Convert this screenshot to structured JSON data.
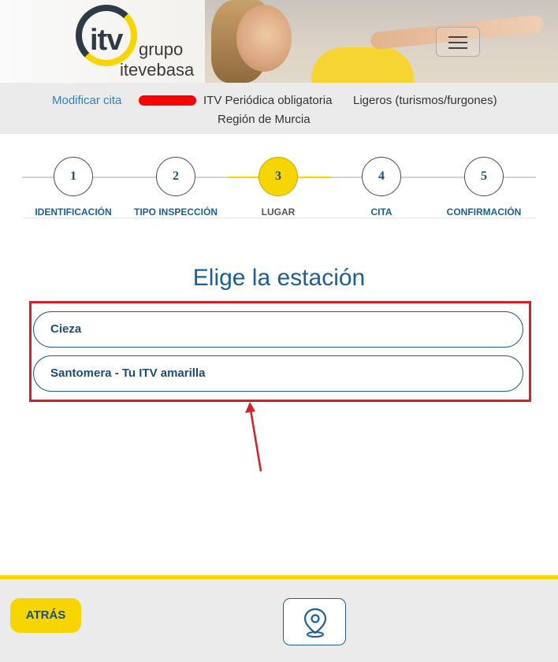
{
  "header": {
    "logo": {
      "mark": "itv",
      "line1": "grupo",
      "line2": "itevebasa"
    },
    "menu_icon": "hamburger-menu-icon"
  },
  "summary": {
    "modify_link": "Modificar cita",
    "inspection_type": "ITV Periódica obligatoria",
    "vehicle_category": "Ligeros (turismos/furgones)",
    "region": "Región de Murcia"
  },
  "steps": [
    {
      "number": "1",
      "label": "IDENTIFICACIÓN",
      "state": "done"
    },
    {
      "number": "2",
      "label": "TIPO INSPECCIÓN",
      "state": "done"
    },
    {
      "number": "3",
      "label": "LUGAR",
      "state": "current"
    },
    {
      "number": "4",
      "label": "CITA",
      "state": "pending"
    },
    {
      "number": "5",
      "label": "CONFIRMACIÓN",
      "state": "pending"
    }
  ],
  "main": {
    "title": "Elige la estación",
    "stations": [
      "Cieza",
      "Santomera - Tu ITV amarilla"
    ]
  },
  "footer": {
    "back_label": "ATRÁS",
    "map_icon": "map-pin-icon"
  },
  "colors": {
    "accent_yellow": "#f6d500",
    "brand_blue": "#1b5f94",
    "link_blue": "#3480bd",
    "highlight_red": "#d41f26"
  }
}
